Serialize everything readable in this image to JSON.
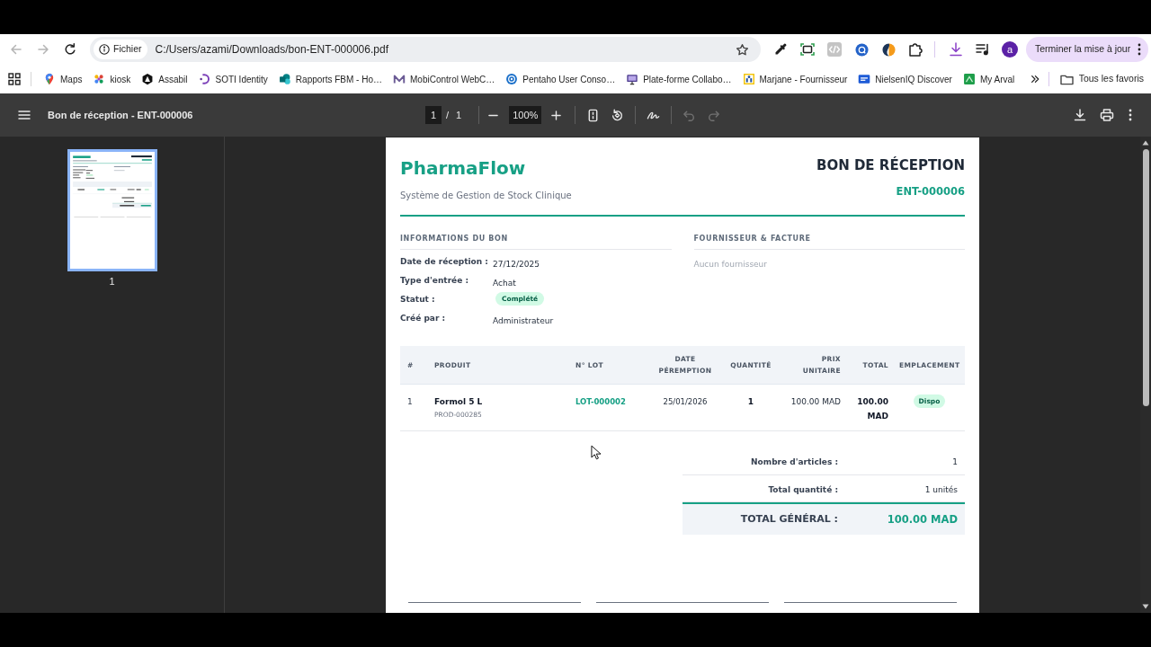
{
  "browser": {
    "nav": [
      {
        "kind": "back",
        "disabled": true
      },
      {
        "kind": "forward",
        "disabled": true
      },
      {
        "kind": "reload",
        "disabled": false
      }
    ],
    "address": {
      "chip": "Fichier",
      "url": "C:/Users/azami/Downloads/bon-ENT-000006.pdf"
    },
    "profile_initial": "a",
    "update_button": "Terminer la mise à jour",
    "bookmarks": [
      "Maps",
      "kiosk",
      "Assabil",
      "SOTI Identity",
      "Rapports FBM - Ho…",
      "MobiControl WebC…",
      "Pentaho User Conso…",
      "Plate-forme Collabo…",
      "Marjane - Fournisseur",
      "NielsenIQ Discover",
      "My Arval"
    ],
    "all_bookmarks": "Tous les favoris"
  },
  "pdf_viewer": {
    "title": "Bon de réception - ENT-000006",
    "page": "1",
    "page_count": "/ 1",
    "zoom": "100%",
    "tools": [
      {
        "kind": "fit_page",
        "disabled": false
      },
      {
        "kind": "rotate",
        "disabled": false
      },
      {
        "kind": "annotate",
        "disabled": false
      },
      {
        "kind": "undo",
        "disabled": true
      },
      {
        "kind": "redo",
        "disabled": true
      }
    ],
    "thumbnails": [
      {
        "label": "1",
        "selected": true
      }
    ]
  },
  "document": {
    "brand": "PharmaFlow",
    "tagline": "Système de Gestion de Stock Clinique",
    "title": "BON DE RÉCEPTION",
    "number": "ENT-000006",
    "info": {
      "heading": "INFORMATIONS DU BON",
      "fields": [
        {
          "label": "Date de réception :",
          "value": "27/12/2025",
          "kind": "text"
        },
        {
          "label": "Type d'entrée :",
          "value": "Achat",
          "kind": "text"
        },
        {
          "label": "Statut :",
          "value": "Complété",
          "kind": "badge"
        },
        {
          "label": "Créé par :",
          "value": "Administrateur",
          "kind": "text"
        }
      ]
    },
    "supplier": {
      "heading": "FOURNISSEUR & FACTURE",
      "empty_text": "Aucun fournisseur"
    },
    "table": {
      "columns": [
        "#",
        "PRODUIT",
        "N° LOT",
        "DATE PÉREMPTION",
        "QUANTITÉ",
        "PRIX UNITAIRE",
        "TOTAL",
        "EMPLACEMENT"
      ],
      "rows": [
        {
          "number": "1",
          "product": "Formol 5 L",
          "product_code": "PROD-000285",
          "lot": "LOT-000002",
          "expiry": "25/01/2026",
          "quantity": "1",
          "unit_price": "100.00 MAD",
          "total": "100.00 MAD",
          "location": "Dispo"
        }
      ]
    },
    "summary": [
      {
        "label": "Nombre d'articles :",
        "value": "1"
      },
      {
        "label": "Total quantité :",
        "value": "1 unités"
      }
    ],
    "grand_total": {
      "label": "TOTAL GÉNÉRAL :",
      "value": "100.00 MAD"
    }
  }
}
